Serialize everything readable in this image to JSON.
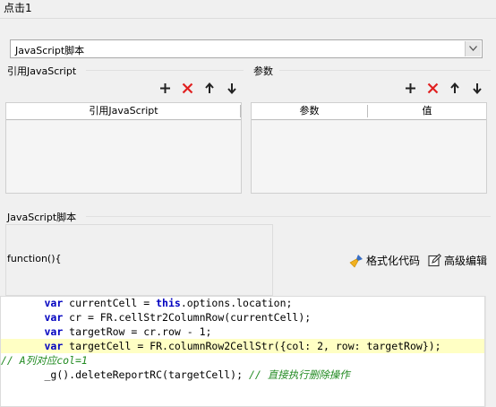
{
  "window": {
    "title": "点击1"
  },
  "script_type_select": {
    "value": "JavaScript脚本"
  },
  "imports": {
    "label": "引用JavaScript",
    "columns": [
      "引用JavaScript"
    ],
    "rows": []
  },
  "params": {
    "label": "参数",
    "columns": [
      "参数",
      "值"
    ],
    "rows": []
  },
  "script": {
    "label": "JavaScript脚本",
    "signature": "function(){",
    "format_label": "格式化代码",
    "advanced_label": "高级编辑",
    "code_lines": [
      {
        "indent": "    ",
        "parts": [
          {
            "t": "var",
            "c": "kw"
          },
          {
            "t": " currentCell = "
          },
          {
            "t": "this",
            "c": "kw"
          },
          {
            "t": ".options.location;"
          }
        ]
      },
      {
        "indent": "    ",
        "parts": [
          {
            "t": "var",
            "c": "kw"
          },
          {
            "t": " cr = FR.cellStr2ColumnRow(currentCell);"
          }
        ]
      },
      {
        "indent": "    ",
        "parts": [
          {
            "t": "var",
            "c": "kw"
          },
          {
            "t": " targetRow = cr.row - 1;"
          }
        ]
      },
      {
        "indent": "    ",
        "highlight": true,
        "parts": [
          {
            "t": "var",
            "c": "kw"
          },
          {
            "t": " targetCell = FR.columnRow2CellStr({col: 2, row: targetRow});"
          }
        ]
      },
      {
        "indent": "",
        "parts": [
          {
            "t": "// A列对应col=1",
            "c": "cmt"
          }
        ]
      },
      {
        "indent": "    ",
        "parts": [
          {
            "t": "_g().deleteReportRC(targetCell); "
          },
          {
            "t": "// 直接执行删除操作",
            "c": "cmt"
          }
        ]
      }
    ]
  },
  "icons": {
    "add": "plus-icon",
    "remove": "red-x-icon",
    "move_up": "arrow-up-icon",
    "move_down": "arrow-down-icon",
    "format": "broom-icon",
    "advanced": "edit-icon"
  },
  "colors": {
    "remove": "#e02020",
    "keyword": "#0000c0",
    "comment": "#228b22",
    "highlight": "#ffffc4"
  }
}
